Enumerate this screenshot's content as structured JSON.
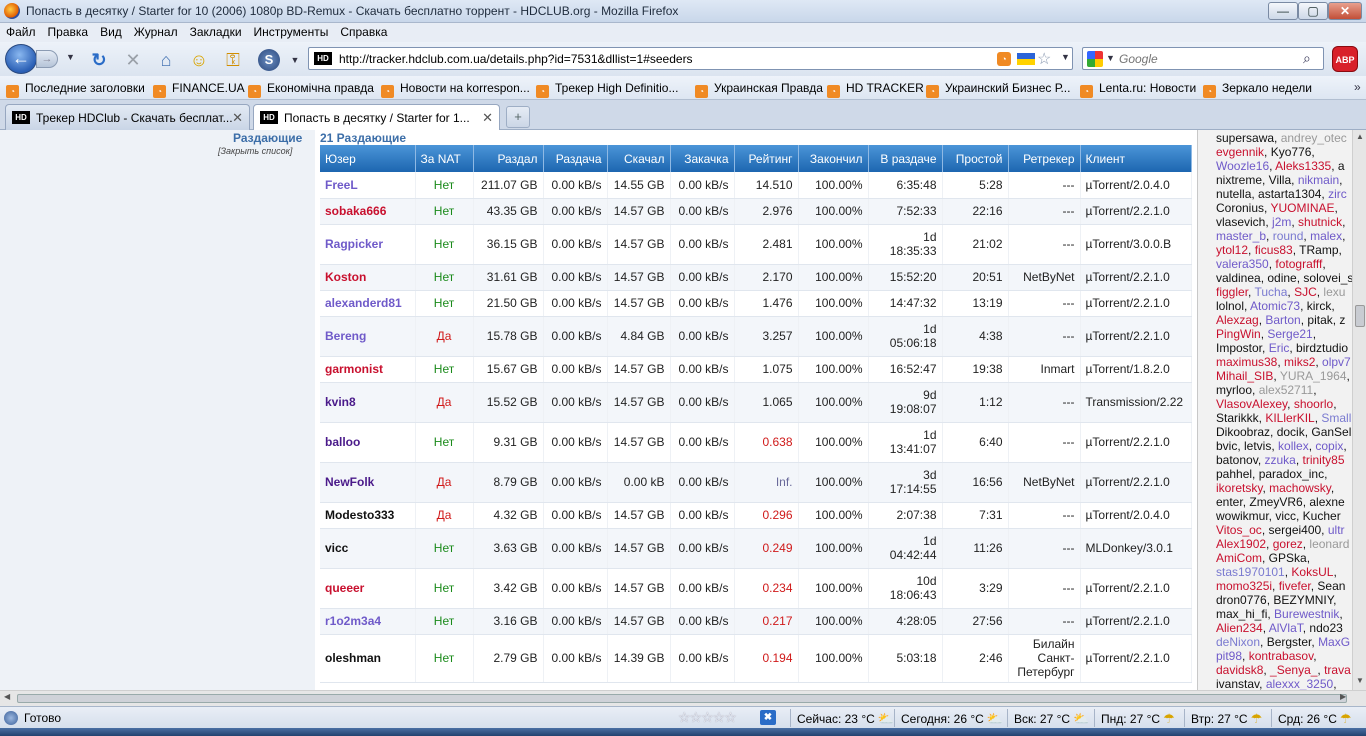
{
  "window": {
    "title": "Попасть в десятку / Starter for 10 (2006) 1080p BD-Remux - Скачать бесплатно торрент - HDCLUB.org - Mozilla Firefox",
    "min": "—",
    "max": "▢",
    "close": "✕"
  },
  "menu": [
    "Файл",
    "Правка",
    "Вид",
    "Журнал",
    "Закладки",
    "Инструменты",
    "Справка"
  ],
  "nav": {
    "url": "http://tracker.hdclub.com.ua/details.php?id=7531&dllist=1#seeders",
    "search_placeholder": "Google",
    "abp": "ABP",
    "favicon": "HD"
  },
  "bookmarks": [
    "Последние заголовки",
    "FINANCE.UA",
    "Економічна правда",
    "Новости на korrespon...",
    "Трекер High Definitio...",
    "Украинская Правда",
    "HD TRACKER",
    "Украинский Бизнес Р...",
    "Lenta.ru: Новости",
    "Зеркало недели"
  ],
  "bookmarks_more": "»",
  "tabs": [
    {
      "label": "Трекер HDClub - Скачать бесплат...",
      "favicon": "HD"
    },
    {
      "label": "Попасть в десятку / Starter for 1...",
      "favicon": "HD"
    }
  ],
  "newtab": "+",
  "content": {
    "section_label": "Раздающие",
    "close_list": "[Закрыть список]",
    "count_label": "21 Раздающие",
    "columns": [
      "Юзер",
      "За NAT",
      "Раздал",
      "Раздача",
      "Скачал",
      "Закачка",
      "Рейтинг",
      "Закончил",
      "В раздаче",
      "Простой",
      "Ретрекер",
      "Клиент"
    ],
    "rows": [
      {
        "user": "FreeL",
        "color": "#6f5ac9",
        "nat": "Нет",
        "uploaded": "211.07 GB",
        "up_speed": "0.00 kB/s",
        "downloaded": "14.55 GB",
        "down_speed": "0.00 kB/s",
        "rating": "14.510",
        "done": "100.00%",
        "seeding": "6:35:48",
        "idle": "5:28",
        "retracker": "---",
        "client": "µTorrent/2.0.4.0"
      },
      {
        "user": "sobaka666",
        "color": "#c8102e",
        "nat": "Нет",
        "uploaded": "43.35 GB",
        "up_speed": "0.00 kB/s",
        "downloaded": "14.57 GB",
        "down_speed": "0.00 kB/s",
        "rating": "2.976",
        "done": "100.00%",
        "seeding": "7:52:33",
        "idle": "22:16",
        "retracker": "---",
        "client": "µTorrent/2.2.1.0"
      },
      {
        "user": "Ragpicker",
        "color": "#6f5ac9",
        "nat": "Нет",
        "uploaded": "36.15 GB",
        "up_speed": "0.00 kB/s",
        "downloaded": "14.57 GB",
        "down_speed": "0.00 kB/s",
        "rating": "2.481",
        "done": "100.00%",
        "seeding": "1d 18:35:33",
        "idle": "21:02",
        "retracker": "---",
        "client": "µTorrent/3.0.0.B"
      },
      {
        "user": "Koston",
        "color": "#c8102e",
        "nat": "Нет",
        "uploaded": "31.61 GB",
        "up_speed": "0.00 kB/s",
        "downloaded": "14.57 GB",
        "down_speed": "0.00 kB/s",
        "rating": "2.170",
        "done": "100.00%",
        "seeding": "15:52:20",
        "idle": "20:51",
        "retracker": "NetByNet",
        "client": "µTorrent/2.2.1.0"
      },
      {
        "user": "alexanderd81",
        "color": "#6f5ac9",
        "nat": "Нет",
        "uploaded": "21.50 GB",
        "up_speed": "0.00 kB/s",
        "downloaded": "14.57 GB",
        "down_speed": "0.00 kB/s",
        "rating": "1.476",
        "done": "100.00%",
        "seeding": "14:47:32",
        "idle": "13:19",
        "retracker": "---",
        "client": "µTorrent/2.2.1.0"
      },
      {
        "user": "Bereng",
        "color": "#6f5ac9",
        "nat": "Да",
        "uploaded": "15.78 GB",
        "up_speed": "0.00 kB/s",
        "downloaded": "4.84 GB",
        "down_speed": "0.00 kB/s",
        "rating": "3.257",
        "done": "100.00%",
        "seeding": "1d 05:06:18",
        "idle": "4:38",
        "retracker": "---",
        "client": "µTorrent/2.2.1.0"
      },
      {
        "user": "garmonist",
        "color": "#c8102e",
        "nat": "Нет",
        "uploaded": "15.67 GB",
        "up_speed": "0.00 kB/s",
        "downloaded": "14.57 GB",
        "down_speed": "0.00 kB/s",
        "rating": "1.075",
        "done": "100.00%",
        "seeding": "16:52:47",
        "idle": "19:38",
        "retracker": "Inmart",
        "client": "µTorrent/1.8.2.0"
      },
      {
        "user": "kvin8",
        "color": "#4a1a8a",
        "nat": "Да",
        "uploaded": "15.52 GB",
        "up_speed": "0.00 kB/s",
        "downloaded": "14.57 GB",
        "down_speed": "0.00 kB/s",
        "rating": "1.065",
        "done": "100.00%",
        "seeding": "9d 19:08:07",
        "idle": "1:12",
        "retracker": "---",
        "client": "Transmission/2.22"
      },
      {
        "user": "balloo",
        "color": "#4a1a8a",
        "nat": "Нет",
        "uploaded": "9.31 GB",
        "up_speed": "0.00 kB/s",
        "downloaded": "14.57 GB",
        "down_speed": "0.00 kB/s",
        "rating": "0.638",
        "done": "100.00%",
        "seeding": "1d 13:41:07",
        "idle": "6:40",
        "retracker": "---",
        "client": "µTorrent/2.2.1.0"
      },
      {
        "user": "NewFolk",
        "color": "#4a1a8a",
        "nat": "Да",
        "uploaded": "8.79 GB",
        "up_speed": "0.00 kB/s",
        "downloaded": "0.00 kB",
        "down_speed": "0.00 kB/s",
        "rating": "Inf.",
        "done": "100.00%",
        "seeding": "3d 17:14:55",
        "idle": "16:56",
        "retracker": "NetByNet",
        "client": "µTorrent/2.2.1.0"
      },
      {
        "user": "Modesto333",
        "color": "#111111",
        "nat": "Да",
        "uploaded": "4.32 GB",
        "up_speed": "0.00 kB/s",
        "downloaded": "14.57 GB",
        "down_speed": "0.00 kB/s",
        "rating": "0.296",
        "done": "100.00%",
        "seeding": "2:07:38",
        "idle": "7:31",
        "retracker": "---",
        "client": "µTorrent/2.0.4.0"
      },
      {
        "user": "vicc",
        "color": "#111111",
        "nat": "Нет",
        "uploaded": "3.63 GB",
        "up_speed": "0.00 kB/s",
        "downloaded": "14.57 GB",
        "down_speed": "0.00 kB/s",
        "rating": "0.249",
        "done": "100.00%",
        "seeding": "1d 04:42:44",
        "idle": "11:26",
        "retracker": "---",
        "client": "MLDonkey/3.0.1"
      },
      {
        "user": "queeer",
        "color": "#c8102e",
        "nat": "Нет",
        "uploaded": "3.42 GB",
        "up_speed": "0.00 kB/s",
        "downloaded": "14.57 GB",
        "down_speed": "0.00 kB/s",
        "rating": "0.234",
        "done": "100.00%",
        "seeding": "10d 18:06:43",
        "idle": "3:29",
        "retracker": "---",
        "client": "µTorrent/2.2.1.0"
      },
      {
        "user": "r1o2m3a4",
        "color": "#6f5ac9",
        "nat": "Нет",
        "uploaded": "3.16 GB",
        "up_speed": "0.00 kB/s",
        "downloaded": "14.57 GB",
        "down_speed": "0.00 kB/s",
        "rating": "0.217",
        "done": "100.00%",
        "seeding": "4:28:05",
        "idle": "27:56",
        "retracker": "---",
        "client": "µTorrent/2.2.1.0"
      },
      {
        "user": "oleshman",
        "color": "#111111",
        "nat": "Нет",
        "uploaded": "2.79 GB",
        "up_speed": "0.00 kB/s",
        "downloaded": "14.39 GB",
        "down_speed": "0.00 kB/s",
        "rating": "0.194",
        "done": "100.00%",
        "seeding": "5:03:18",
        "idle": "2:46",
        "retracker": "Билайн Санкт-Петербург",
        "client": "µTorrent/2.2.1.0"
      }
    ]
  },
  "userlist": [
    [
      {
        "t": "supersawa, ",
        "c": "#111"
      },
      {
        "t": "andrey_otec",
        "c": "#999"
      }
    ],
    [
      {
        "t": "evgennik",
        "c": "#c8102e"
      },
      {
        "t": ", Kyo776,",
        "c": "#111"
      }
    ],
    [
      {
        "t": "Woozle16",
        "c": "#6f5ac9"
      },
      {
        "t": ", ",
        "c": "#111"
      },
      {
        "t": "Aleks1335",
        "c": "#c8102e"
      },
      {
        "t": ", a",
        "c": "#111"
      }
    ],
    [
      {
        "t": "nixtreme, Villa, ",
        "c": "#111"
      },
      {
        "t": "nikmain",
        "c": "#6f5ac9"
      },
      {
        "t": ",",
        "c": "#111"
      }
    ],
    [
      {
        "t": "nutella, astarta1304, ",
        "c": "#111"
      },
      {
        "t": "zirc",
        "c": "#6f5ac9"
      }
    ],
    [
      {
        "t": "Coronius, ",
        "c": "#111"
      },
      {
        "t": "YUOMINAE",
        "c": "#c8102e"
      },
      {
        "t": ",",
        "c": "#111"
      }
    ],
    [
      {
        "t": "vlasevich, ",
        "c": "#111"
      },
      {
        "t": "j2m",
        "c": "#6f5ac9"
      },
      {
        "t": ", ",
        "c": "#111"
      },
      {
        "t": "shutnick",
        "c": "#c8102e"
      },
      {
        "t": ",",
        "c": "#111"
      }
    ],
    [
      {
        "t": "master_b",
        "c": "#6f5ac9"
      },
      {
        "t": ", ",
        "c": "#111"
      },
      {
        "t": "round",
        "c": "#7a7ad0"
      },
      {
        "t": ", ",
        "c": "#111"
      },
      {
        "t": "malex",
        "c": "#6f5ac9"
      },
      {
        "t": ",",
        "c": "#111"
      }
    ],
    [
      {
        "t": "ytol12",
        "c": "#c8102e"
      },
      {
        "t": ", ",
        "c": "#111"
      },
      {
        "t": "ficus83",
        "c": "#c8102e"
      },
      {
        "t": ", TRamp,",
        "c": "#111"
      }
    ],
    [
      {
        "t": "valera350",
        "c": "#6f5ac9"
      },
      {
        "t": ", ",
        "c": "#111"
      },
      {
        "t": "fotografff",
        "c": "#c8102e"
      },
      {
        "t": ",",
        "c": "#111"
      }
    ],
    [
      {
        "t": "valdinea, odine, solovei_s",
        "c": "#111"
      }
    ],
    [
      {
        "t": "figgler",
        "c": "#c8102e"
      },
      {
        "t": ", ",
        "c": "#111"
      },
      {
        "t": "Tucha",
        "c": "#7a7ad0"
      },
      {
        "t": ", ",
        "c": "#111"
      },
      {
        "t": "SJC",
        "c": "#c8102e"
      },
      {
        "t": ", ",
        "c": "#111"
      },
      {
        "t": "lexu",
        "c": "#999"
      }
    ],
    [
      {
        "t": "lolnol, ",
        "c": "#111"
      },
      {
        "t": "Atomic73",
        "c": "#6f5ac9"
      },
      {
        "t": ", kirck,",
        "c": "#111"
      }
    ],
    [
      {
        "t": "Alexzag",
        "c": "#c8102e"
      },
      {
        "t": ", ",
        "c": "#111"
      },
      {
        "t": "Barton",
        "c": "#6f5ac9"
      },
      {
        "t": ", pitak, z",
        "c": "#111"
      }
    ],
    [
      {
        "t": "PingWin",
        "c": "#c8102e"
      },
      {
        "t": ", ",
        "c": "#111"
      },
      {
        "t": "Serge21",
        "c": "#6f5ac9"
      },
      {
        "t": ",",
        "c": "#111"
      }
    ],
    [
      {
        "t": "Impostor, ",
        "c": "#111"
      },
      {
        "t": "Eric",
        "c": "#6f5ac9"
      },
      {
        "t": ", birdztudio",
        "c": "#111"
      }
    ],
    [
      {
        "t": "maximus38",
        "c": "#c8102e"
      },
      {
        "t": ", ",
        "c": "#111"
      },
      {
        "t": "miks2",
        "c": "#c8102e"
      },
      {
        "t": ", ",
        "c": "#111"
      },
      {
        "t": "olpv7",
        "c": "#6f5ac9"
      }
    ],
    [
      {
        "t": "Mihail_SIB",
        "c": "#c8102e"
      },
      {
        "t": ", ",
        "c": "#111"
      },
      {
        "t": "YURA_1964",
        "c": "#999"
      },
      {
        "t": ",",
        "c": "#111"
      }
    ],
    [
      {
        "t": "myrloo, ",
        "c": "#111"
      },
      {
        "t": "alex52711",
        "c": "#999"
      },
      {
        "t": ",",
        "c": "#111"
      }
    ],
    [
      {
        "t": "VlasovAlexey",
        "c": "#c8102e"
      },
      {
        "t": ", ",
        "c": "#111"
      },
      {
        "t": "shoorlo",
        "c": "#c8102e"
      },
      {
        "t": ",",
        "c": "#111"
      }
    ],
    [
      {
        "t": "Starikkk, ",
        "c": "#111"
      },
      {
        "t": "KILlerKIL",
        "c": "#c8102e"
      },
      {
        "t": ", ",
        "c": "#111"
      },
      {
        "t": "Small",
        "c": "#7a7ad0"
      }
    ],
    [
      {
        "t": "Dikoobraz, docik, GanSel",
        "c": "#111"
      }
    ],
    [
      {
        "t": "bvic, letvis, ",
        "c": "#111"
      },
      {
        "t": "kollex",
        "c": "#6f5ac9"
      },
      {
        "t": ", ",
        "c": "#111"
      },
      {
        "t": "copix",
        "c": "#6f5ac9"
      },
      {
        "t": ",",
        "c": "#111"
      }
    ],
    [
      {
        "t": "batonov, ",
        "c": "#111"
      },
      {
        "t": "zzuka",
        "c": "#6f5ac9"
      },
      {
        "t": ", ",
        "c": "#111"
      },
      {
        "t": "trinity85",
        "c": "#c8102e"
      }
    ],
    [
      {
        "t": "pahhel, paradox_inc,",
        "c": "#111"
      }
    ],
    [
      {
        "t": "ikoretsky",
        "c": "#c8102e"
      },
      {
        "t": ", ",
        "c": "#111"
      },
      {
        "t": "machowsky",
        "c": "#c8102e"
      },
      {
        "t": ",",
        "c": "#111"
      }
    ],
    [
      {
        "t": "enter, ZmeyVR6, alexne",
        "c": "#111"
      }
    ],
    [
      {
        "t": "wowikmur, vicc, Kucher",
        "c": "#111"
      }
    ],
    [
      {
        "t": "Vitos_oc",
        "c": "#c8102e"
      },
      {
        "t": ", sergei400, ",
        "c": "#111"
      },
      {
        "t": "ultr",
        "c": "#6f5ac9"
      }
    ],
    [
      {
        "t": "Alex1902",
        "c": "#c8102e"
      },
      {
        "t": ", ",
        "c": "#111"
      },
      {
        "t": "gorez",
        "c": "#c8102e"
      },
      {
        "t": ", ",
        "c": "#111"
      },
      {
        "t": "leonard",
        "c": "#999"
      }
    ],
    [
      {
        "t": "AmiCom",
        "c": "#c8102e"
      },
      {
        "t": ", GPSka,",
        "c": "#111"
      }
    ],
    [
      {
        "t": "stas1970101",
        "c": "#7a7ad0"
      },
      {
        "t": ", ",
        "c": "#111"
      },
      {
        "t": "KoksUL",
        "c": "#c8102e"
      },
      {
        "t": ",",
        "c": "#111"
      }
    ],
    [
      {
        "t": "momo325i",
        "c": "#c8102e"
      },
      {
        "t": ", ",
        "c": "#111"
      },
      {
        "t": "fivefer",
        "c": "#c8102e"
      },
      {
        "t": ", Sean",
        "c": "#111"
      }
    ],
    [
      {
        "t": "dron0776, BEZYMNIY,",
        "c": "#111"
      }
    ],
    [
      {
        "t": "max_hi_fi, ",
        "c": "#111"
      },
      {
        "t": "Burewestnik",
        "c": "#6f5ac9"
      },
      {
        "t": ",",
        "c": "#111"
      }
    ],
    [
      {
        "t": "Alien234",
        "c": "#c8102e"
      },
      {
        "t": ", ",
        "c": "#111"
      },
      {
        "t": "AlVlaT",
        "c": "#6f5ac9"
      },
      {
        "t": ", ndo23",
        "c": "#111"
      }
    ],
    [
      {
        "t": "deNixon",
        "c": "#7a7ad0"
      },
      {
        "t": ", Bergster, ",
        "c": "#111"
      },
      {
        "t": "MaxG",
        "c": "#6f5ac9"
      }
    ],
    [
      {
        "t": "pit98",
        "c": "#6f5ac9"
      },
      {
        "t": ", ",
        "c": "#111"
      },
      {
        "t": "kontrabasov",
        "c": "#c8102e"
      },
      {
        "t": ",",
        "c": "#111"
      }
    ],
    [
      {
        "t": "davidsk8",
        "c": "#c8102e"
      },
      {
        "t": ", ",
        "c": "#111"
      },
      {
        "t": "_Senya_",
        "c": "#c8102e"
      },
      {
        "t": ", ",
        "c": "#111"
      },
      {
        "t": "trava",
        "c": "#c8102e"
      }
    ],
    [
      {
        "t": "ivanstav, ",
        "c": "#111"
      },
      {
        "t": "alexxx_3250",
        "c": "#6f5ac9"
      },
      {
        "t": ",",
        "c": "#111"
      }
    ]
  ],
  "status": {
    "text": "Готово",
    "stars": "☆☆☆☆☆",
    "weather": [
      {
        "label": "Сейчас: 23 °C"
      },
      {
        "label": "Сегодня: 26 °C"
      },
      {
        "label": "Вск: 27 °C"
      },
      {
        "label": "Пнд: 27 °C"
      },
      {
        "label": "Втр: 27 °C"
      },
      {
        "label": "Срд: 26 °C"
      }
    ]
  },
  "colors": {
    "header_blue": "#1d66b0",
    "link_red": "#c8102e",
    "link_violet": "#6f5ac9",
    "nat_yes": "#d01a1a",
    "nat_no": "#1a8a1a"
  }
}
